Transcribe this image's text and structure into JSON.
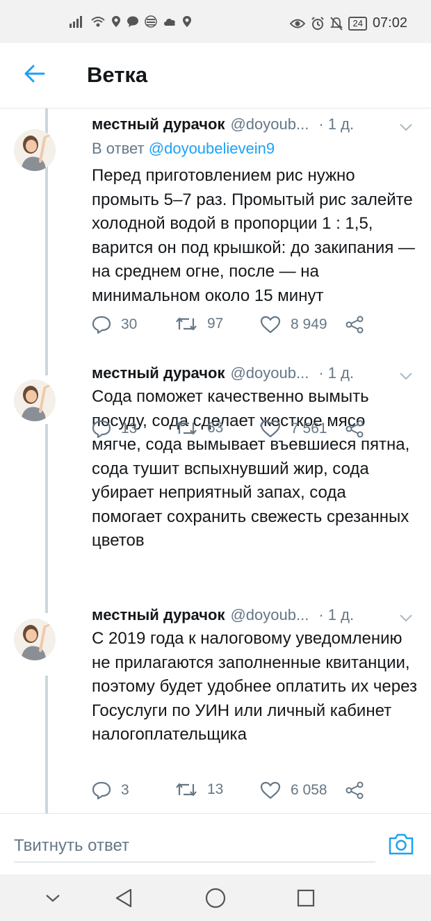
{
  "status_bar": {
    "left_icons": [
      "signal-icon",
      "wifi-icon",
      "location-icon",
      "chat-icon",
      "equal-icon",
      "cloud-icon",
      "location-icon"
    ],
    "battery": "24",
    "time": "07:02"
  },
  "header": {
    "title": "Ветка"
  },
  "tweets": [
    {
      "author": "местный дурачок",
      "handle": "@doyoub...",
      "time": "· 1 д.",
      "reply_label": "В ответ",
      "reply_handle": "@doyoubelievein9",
      "text": "Перед приготовлением рис нужно промыть 5–7 раз. Промытый рис залейте холодной водой в пропорции 1 : 1,5, варится он под крышкой: до закипания — на среднем огне, после — на минимальном около 15 минут",
      "replies": "30",
      "retweets": "97",
      "likes": "8 949"
    },
    {
      "author": "местный дурачок",
      "handle": "@doyoub...",
      "time": "· 1 д.",
      "text": "Сода поможет качественно вымыть посуду, сода сделает жесткое мясо мягче, сода вымывает въевшиеся пятна, сода тушит вспыхнувший жир, сода убирает неприятный запах, сода помогает сохранить свежесть срезанных цветов",
      "replies": "13",
      "retweets": "63",
      "likes": "7 561"
    },
    {
      "author": "местный дурачок",
      "handle": "@doyoub...",
      "time": "· 1 д.",
      "text": "С 2019 года к налоговому уведомлению не прилагаются заполненные квитанции, поэтому будет удобнее оплатить их через Госуслуги по УИН или личный кабинет налогоплательщика",
      "replies": "3",
      "retweets": "13",
      "likes": "6 058"
    }
  ],
  "compose": {
    "placeholder": "Твитнуть ответ"
  },
  "colors": {
    "accent": "#1da1f2",
    "secondary_text": "#657786",
    "divider": "#e1e8ed"
  }
}
